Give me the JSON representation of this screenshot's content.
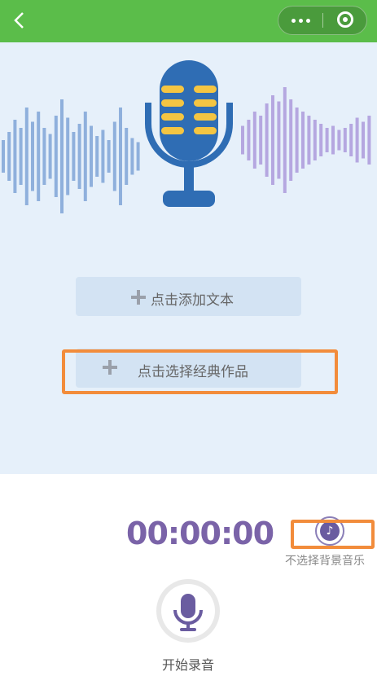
{
  "topbar": {
    "back_icon": "chevron-left-icon",
    "more_icon": "more-dots-icon",
    "close_icon": "circle-close-icon",
    "color": "#5bbd4a"
  },
  "hero": {
    "background": "#e6f0fa",
    "microphone_icon": "microphone-illustration",
    "wave_colors": [
      "#8fb0dc",
      "#b5a7e0"
    ]
  },
  "actions": {
    "add_text_label": "点击添加文本",
    "select_classic_label": "点击选择经典作品"
  },
  "recorder": {
    "timer": "00:00:00",
    "music_icon": "music-note-icon",
    "music_label": "不选择背景音乐",
    "record_icon": "microphone-icon",
    "record_label": "开始录音",
    "accent": "#7a63a8"
  }
}
